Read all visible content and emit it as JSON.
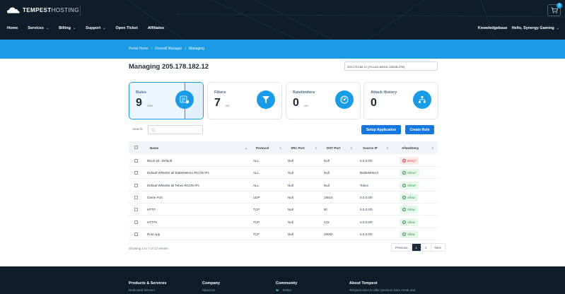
{
  "brand": {
    "name_bold": "TEMPEST",
    "name_light": "HOSTING"
  },
  "cart": {
    "count": "0"
  },
  "nav": {
    "left": [
      {
        "label": "Home",
        "dropdown": false
      },
      {
        "label": "Services",
        "dropdown": true
      },
      {
        "label": "Billing",
        "dropdown": true
      },
      {
        "label": "Support",
        "dropdown": true
      },
      {
        "label": "Open Ticket",
        "dropdown": false
      },
      {
        "label": "Affiliates",
        "dropdown": false
      }
    ],
    "right": [
      {
        "label": "Knowledgebase",
        "dropdown": false
      },
      {
        "label": "Hello, Synergy Gaming",
        "dropdown": true
      }
    ]
  },
  "breadcrumb": {
    "items": [
      "Portal Home",
      "Firewall Manager",
      "Managing"
    ],
    "separator": "/"
  },
  "page": {
    "title": "Managing 205.178.182.12",
    "server_select": "205.178.182.12 (TH-LAX-6900X-128GB-2TB)"
  },
  "cards": [
    {
      "label": "Rules",
      "value": "9",
      "max": "/100",
      "icon": "rules-list-icon",
      "active": true
    },
    {
      "label": "Filters",
      "value": "7",
      "max": "/20",
      "icon": "filter-funnel-icon",
      "active": false
    },
    {
      "label": "Ratelimiters",
      "value": "0",
      "max": "/20",
      "icon": "speed-gauge-icon",
      "active": false
    },
    {
      "label": "Attack History",
      "value": "0",
      "max": "",
      "icon": "network-tree-icon",
      "active": false
    }
  ],
  "controls": {
    "search_label": "Search:",
    "search_placeholder": "",
    "setup_button": "Setup Application",
    "create_button": "Create Rule"
  },
  "table": {
    "columns": [
      "Name",
      "Protocol",
      "SRC Port",
      "DST Port",
      "Source IP",
      "Allow/Deny"
    ],
    "rows": [
      {
        "name": "Block all - Default",
        "protocol": "ALL",
        "src": "Null",
        "dst": "Null",
        "source_ip": "0.0.0.0/0",
        "action": "Deny*",
        "type": "deny"
      },
      {
        "name": "Default Whitelist all BattleMetrics RCON IPs",
        "protocol": "ALL",
        "src": "Null",
        "dst": "Null",
        "source_ip": "BattleMetrics",
        "action": "Allow*",
        "type": "allow"
      },
      {
        "name": "Default Whitelist all Tebex RCON IPs",
        "protocol": "ALL",
        "src": "Null",
        "dst": "Null",
        "source_ip": "Tebex",
        "action": "Allow*",
        "type": "allow"
      },
      {
        "name": "Game Port",
        "protocol": "UDP",
        "src": "Null",
        "dst": "28015",
        "source_ip": "0.0.0.0/0",
        "action": "Allow",
        "type": "allow"
      },
      {
        "name": "HTTP",
        "protocol": "TCP",
        "src": "Null",
        "dst": "80",
        "source_ip": "0.0.0.0/0",
        "action": "Allow",
        "type": "allow"
      },
      {
        "name": "HTTPs",
        "protocol": "TCP",
        "src": "Null",
        "dst": "443",
        "source_ip": "0.0.0.0/0",
        "action": "Allow",
        "type": "allow"
      },
      {
        "name": "Rust App",
        "protocol": "TCP",
        "src": "Null",
        "dst": "28082",
        "source_ip": "0.0.0.0/0",
        "action": "Allow",
        "type": "allow"
      }
    ],
    "showing": "Showing 1 to 7 of 12 entries",
    "pagination": [
      "Previous",
      "1",
      "2",
      "Next"
    ],
    "current_page": "1"
  },
  "footer": {
    "columns": [
      {
        "heading": "Products & Services",
        "link": "Dedicated Servers"
      },
      {
        "heading": "Company",
        "link": "About Us"
      },
      {
        "heading": "Community",
        "link": "Twitter"
      },
      {
        "heading": "About Tempest",
        "link": "Tempest aims to offer premium bare metal and"
      }
    ]
  },
  "colors": {
    "accent": "#1a9be6",
    "button": "#1578e0",
    "navbar": "#0f1d2b",
    "allow": "#2e9b4a",
    "deny": "#d83a3a"
  }
}
